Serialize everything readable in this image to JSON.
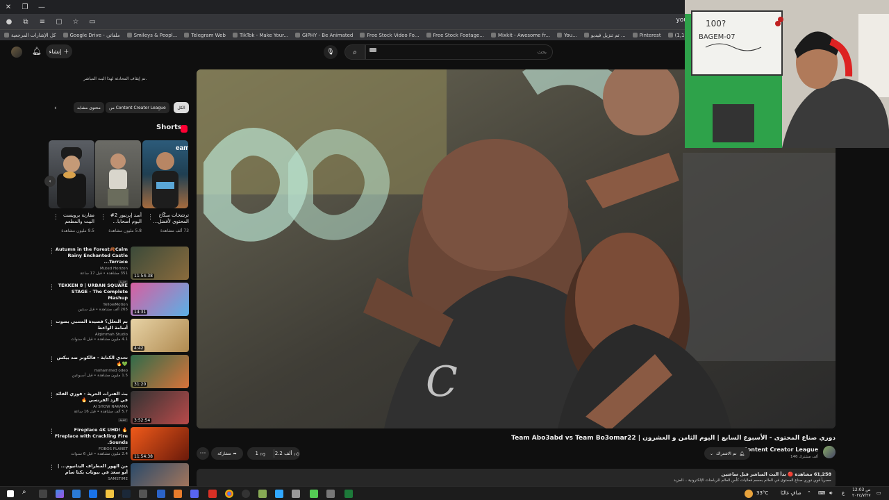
{
  "browser": {
    "window_controls": [
      "✕",
      "❐",
      "—"
    ],
    "url_fragment": "you",
    "bookmarks": [
      {
        "label": "كل الإشارات المرجعية",
        "icon": "folder-icon"
      },
      {
        "label": "Google Drive - ملفاتي",
        "icon": "drive-icon"
      },
      {
        "label": "Smileys & Peopl...",
        "icon": "emoji-icon"
      },
      {
        "label": "Telegram Web",
        "icon": "telegram-icon"
      },
      {
        "label": "TikTok - Make Your...",
        "icon": "tiktok-icon"
      },
      {
        "label": "GIPHY - Be Animated",
        "icon": "giphy-icon"
      },
      {
        "label": "Free Stock Video Fo...",
        "icon": "video-icon"
      },
      {
        "label": "Free Stock Footage...",
        "icon": "video-icon"
      },
      {
        "label": "Mixkit - Awesome fr...",
        "icon": "mixkit-icon"
      },
      {
        "label": "You...",
        "icon": "youtube-icon"
      },
      {
        "label": "تم تنزيل فيديو ...",
        "icon": "download-icon"
      },
      {
        "label": "Pinterest",
        "icon": "pinterest-icon"
      },
      {
        "label": "البريد الوارد - (1,177)",
        "icon": "mail-icon"
      },
      {
        "label": "1.0 Tier List and...",
        "icon": "tier-icon"
      }
    ]
  },
  "youtube": {
    "create_label": "إنشاء",
    "search_placeholder": "بحث",
    "live_note": "تم إيقاف المحادثة لهذا البث المباشر.",
    "chips": [
      "الكل",
      "من Content Creator League",
      "محتوى مشابه"
    ],
    "shorts_heading": "Shorts",
    "shorts": [
      {
        "title": "ترشحات سكّاح المحتوى لأفضل...",
        "views": "73 ألف مشاهدة"
      },
      {
        "title": "أسد إيرنيور 2# اليوم أصحابا...",
        "views": "5.8 مليون مشاهدة"
      },
      {
        "title": "مقارنة برويست البيت والمطعم",
        "views": "9.5 مليون مشاهدة"
      }
    ],
    "recommendations": [
      {
        "title": "Autumn in the Forest🍂Calm Rainy Enchanted Castle Terrace...",
        "channel": "Muted Horizon",
        "meta": "351 مشاهدة • قبل 17 ساعة",
        "badge": "جديد",
        "duration": "11:54:38"
      },
      {
        "title": "TEKKEN 8 | URBAN SQUARE STAGE - The Complete Mashup",
        "channel": "YellowMotion",
        "meta": "265 ألف مشاهدة • قبل سنتين",
        "badge": "",
        "duration": "14:31"
      },
      {
        "title": "بم التعلل؟ قصيدة المتنبي بصوت أسامة الواعظ",
        "channel": "Alqimmah Studio",
        "meta": "4.1 مليون مشاهدة • قبل 4 سنوات",
        "badge": "",
        "duration": "4:42"
      },
      {
        "title": "تحدي الكتابة - فالكونز ضد بيكس 💚🔥",
        "channel": "mohammed odeo",
        "meta": "1.5 مليون مشاهدة • قبل أسبوعين",
        "badge": "",
        "duration": "31:20"
      },
      {
        "title": "بث الفترات الحرية - فوزي الفائد في الزد الفرنسي 🔥",
        "channel": "AI SHOW NAKAMA",
        "meta": "5.7 ألف مشاهدة • قبل 16 ساعة",
        "badge": "جديد",
        "duration": "3:52:54"
      },
      {
        "title": "🔥 Fireplace 4K UHD! Fireplace with Crackling Fire Sounds.",
        "channel": "FOBOS PLANET",
        "meta": "2.4 مليون مشاهدة • قبل 6 سنوات",
        "badge": "",
        "duration": "11:54:38"
      },
      {
        "title": "من الهور المطراف اليتانيوم... | أبو سعد في بيوتات يكتا سام",
        "channel": "SAMSTIME",
        "meta": "",
        "badge": "",
        "duration": ""
      }
    ],
    "video": {
      "title": "دوري صناع المحتوى - الأسبوع السابع | اليوم الثامن و العشرون | Team Abo3abd vs Team Bo3omar22",
      "channel": "Content Creator League",
      "subscribers": "146 ألف مشترك",
      "subscribe_label": "تم الاشتراك",
      "likes": "2.2 ألف",
      "dislike_count": "1",
      "share_label": "مشاركة",
      "desc_stats": "61,258 مشاهدة 🔴 بدأ البث المباشر قبل ساعتين",
      "desc_text": "حصرياً قوي دوري صناع المحتوى في العالم بحسم فعاليات كأس العالم للرياضات الإلكترونية ...المزيد"
    },
    "webcam_board_text": [
      "100?",
      "BAGEM-07"
    ]
  },
  "taskbar": {
    "weather": "33°C",
    "weather_desc": "صافٍ غالبًا",
    "time": "12:03 ص",
    "date": "٢٠٢٤/٧/٢٧",
    "lang": "ع"
  }
}
